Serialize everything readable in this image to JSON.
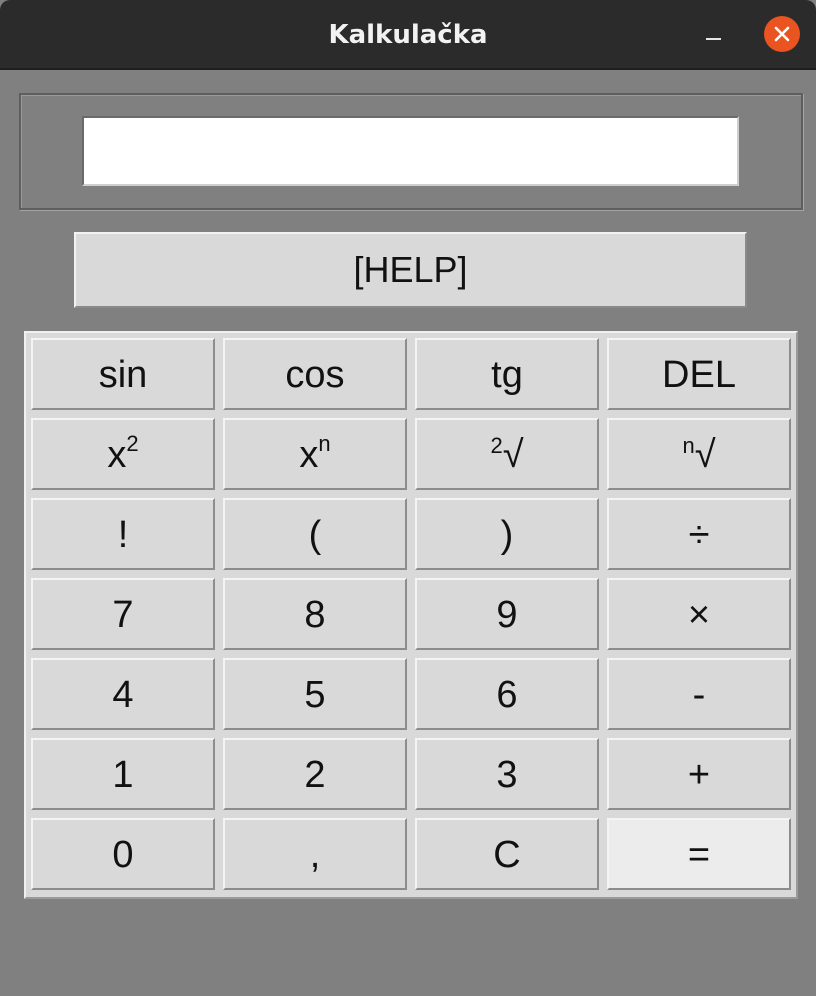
{
  "window": {
    "title": "Kalkulačka"
  },
  "display": {
    "value": ""
  },
  "help_label": "[HELP]",
  "keys": {
    "sin": "sin",
    "cos": "cos",
    "tg": "tg",
    "del": "DEL",
    "x2_base": "x",
    "x2_sup": "2",
    "xn_base": "x",
    "xn_sup": "n",
    "sqrt2_index": "2",
    "sqrt2_sign": "√",
    "sqrtn_index": "n",
    "sqrtn_sign": "√",
    "factorial": "!",
    "lparen": "(",
    "rparen": ")",
    "divide": "÷",
    "seven": "7",
    "eight": "8",
    "nine": "9",
    "multiply": "×",
    "four": "4",
    "five": "5",
    "six": "6",
    "minus": "-",
    "one": "1",
    "two": "2",
    "three": "3",
    "plus": "+",
    "zero": "0",
    "comma": ",",
    "clear": "C",
    "equals": "="
  },
  "icons": {
    "minimize": "minimize-icon",
    "close": "close-icon"
  },
  "colors": {
    "titlebar": "#2b2b2b",
    "close_button": "#e95420",
    "window_bg": "#808080",
    "key_bg": "#d9d9d9",
    "key_active_bg": "#ececec"
  }
}
